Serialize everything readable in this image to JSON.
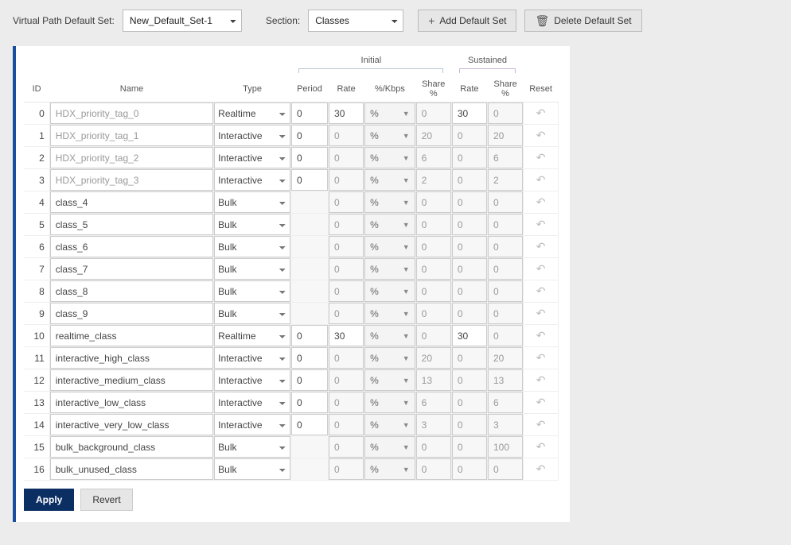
{
  "labels": {
    "vp_default_set": "Virtual Path Default Set:",
    "section": "Section:",
    "add_default_set": "Add Default Set",
    "delete_default_set": "Delete Default Set",
    "plus": "+",
    "trash": "🗑"
  },
  "selects": {
    "vp_default_set_value": "New_Default_Set-1",
    "section_value": "Classes"
  },
  "headers": {
    "initial": "Initial",
    "sustained": "Sustained",
    "id": "ID",
    "name": "Name",
    "type": "Type",
    "period": "Period",
    "rate": "Rate",
    "per_kbps": "%/Kbps",
    "share": "Share %",
    "reset": "Reset"
  },
  "buttons": {
    "apply": "Apply",
    "revert": "Revert"
  },
  "type_options": [
    "Realtime",
    "Interactive",
    "Bulk"
  ],
  "rows": [
    {
      "id": 0,
      "name": "HDX_priority_tag_0",
      "name_disabled": true,
      "type": "Realtime",
      "period": "0",
      "rate": "30",
      "rate_kind": "%",
      "rate_grey": false,
      "share": "0",
      "sus_rate": "30",
      "sus_rate_grey": false,
      "sus_share": "0"
    },
    {
      "id": 1,
      "name": "HDX_priority_tag_1",
      "name_disabled": true,
      "type": "Interactive",
      "period": "0",
      "rate": "0",
      "rate_kind": "%",
      "rate_grey": true,
      "share": "20",
      "sus_rate": "0",
      "sus_rate_grey": true,
      "sus_share": "20"
    },
    {
      "id": 2,
      "name": "HDX_priority_tag_2",
      "name_disabled": true,
      "type": "Interactive",
      "period": "0",
      "rate": "0",
      "rate_kind": "%",
      "rate_grey": true,
      "share": "6",
      "sus_rate": "0",
      "sus_rate_grey": true,
      "sus_share": "6"
    },
    {
      "id": 3,
      "name": "HDX_priority_tag_3",
      "name_disabled": true,
      "type": "Interactive",
      "period": "0",
      "rate": "0",
      "rate_kind": "%",
      "rate_grey": true,
      "share": "2",
      "sus_rate": "0",
      "sus_rate_grey": true,
      "sus_share": "2"
    },
    {
      "id": 4,
      "name": "class_4",
      "name_disabled": false,
      "type": "Bulk",
      "period": "",
      "rate": "0",
      "rate_kind": "%",
      "rate_grey": true,
      "share": "0",
      "sus_rate": "0",
      "sus_rate_grey": true,
      "sus_share": "0"
    },
    {
      "id": 5,
      "name": "class_5",
      "name_disabled": false,
      "type": "Bulk",
      "period": "",
      "rate": "0",
      "rate_kind": "%",
      "rate_grey": true,
      "share": "0",
      "sus_rate": "0",
      "sus_rate_grey": true,
      "sus_share": "0"
    },
    {
      "id": 6,
      "name": "class_6",
      "name_disabled": false,
      "type": "Bulk",
      "period": "",
      "rate": "0",
      "rate_kind": "%",
      "rate_grey": true,
      "share": "0",
      "sus_rate": "0",
      "sus_rate_grey": true,
      "sus_share": "0"
    },
    {
      "id": 7,
      "name": "class_7",
      "name_disabled": false,
      "type": "Bulk",
      "period": "",
      "rate": "0",
      "rate_kind": "%",
      "rate_grey": true,
      "share": "0",
      "sus_rate": "0",
      "sus_rate_grey": true,
      "sus_share": "0"
    },
    {
      "id": 8,
      "name": "class_8",
      "name_disabled": false,
      "type": "Bulk",
      "period": "",
      "rate": "0",
      "rate_kind": "%",
      "rate_grey": true,
      "share": "0",
      "sus_rate": "0",
      "sus_rate_grey": true,
      "sus_share": "0"
    },
    {
      "id": 9,
      "name": "class_9",
      "name_disabled": false,
      "type": "Bulk",
      "period": "",
      "rate": "0",
      "rate_kind": "%",
      "rate_grey": true,
      "share": "0",
      "sus_rate": "0",
      "sus_rate_grey": true,
      "sus_share": "0"
    },
    {
      "id": 10,
      "name": "realtime_class",
      "name_disabled": false,
      "type": "Realtime",
      "period": "0",
      "rate": "30",
      "rate_kind": "%",
      "rate_grey": false,
      "share": "0",
      "sus_rate": "30",
      "sus_rate_grey": false,
      "sus_share": "0"
    },
    {
      "id": 11,
      "name": "interactive_high_class",
      "name_disabled": false,
      "type": "Interactive",
      "period": "0",
      "rate": "0",
      "rate_kind": "%",
      "rate_grey": true,
      "share": "20",
      "sus_rate": "0",
      "sus_rate_grey": true,
      "sus_share": "20"
    },
    {
      "id": 12,
      "name": "interactive_medium_class",
      "name_disabled": false,
      "type": "Interactive",
      "period": "0",
      "rate": "0",
      "rate_kind": "%",
      "rate_grey": true,
      "share": "13",
      "sus_rate": "0",
      "sus_rate_grey": true,
      "sus_share": "13"
    },
    {
      "id": 13,
      "name": "interactive_low_class",
      "name_disabled": false,
      "type": "Interactive",
      "period": "0",
      "rate": "0",
      "rate_kind": "%",
      "rate_grey": true,
      "share": "6",
      "sus_rate": "0",
      "sus_rate_grey": true,
      "sus_share": "6"
    },
    {
      "id": 14,
      "name": "interactive_very_low_class",
      "name_disabled": false,
      "type": "Interactive",
      "period": "0",
      "rate": "0",
      "rate_kind": "%",
      "rate_grey": true,
      "share": "3",
      "sus_rate": "0",
      "sus_rate_grey": true,
      "sus_share": "3"
    },
    {
      "id": 15,
      "name": "bulk_background_class",
      "name_disabled": false,
      "type": "Bulk",
      "period": "",
      "rate": "0",
      "rate_kind": "%",
      "rate_grey": true,
      "share": "0",
      "sus_rate": "0",
      "sus_rate_grey": true,
      "sus_share": "100"
    },
    {
      "id": 16,
      "name": "bulk_unused_class",
      "name_disabled": false,
      "type": "Bulk",
      "period": "",
      "rate": "0",
      "rate_kind": "%",
      "rate_grey": true,
      "share": "0",
      "sus_rate": "0",
      "sus_rate_grey": true,
      "sus_share": "0"
    }
  ]
}
